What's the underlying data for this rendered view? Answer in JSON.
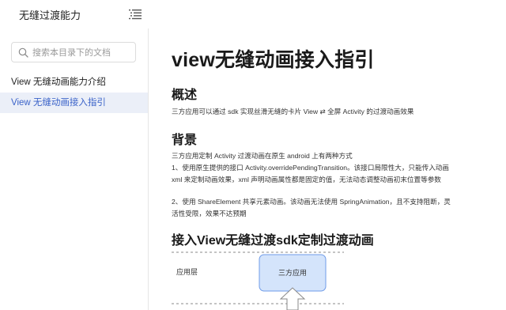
{
  "sidebar": {
    "title": "无缝过渡能力",
    "search_placeholder": "搜索本目录下的文档",
    "items": [
      {
        "label": "View 无缝动画能力介绍",
        "active": false
      },
      {
        "label": "View 无缝动画接入指引",
        "active": true
      }
    ]
  },
  "article": {
    "title": "view无缝动画接入指引",
    "sections": [
      {
        "heading": "概述",
        "paragraphs": [
          "三方应用可以通过 sdk 实现丝滑无缝的卡片 View ⇄ 全屏 Activity 的过渡动画效果"
        ]
      },
      {
        "heading": "背景",
        "paragraphs": [
          "三方应用定制 Activity 过渡动画在原生 android 上有两种方式",
          "1、使用原生提供的接口 Activity.overridePendingTransition。该接口局限性大，只能传入动画 xml 来定制动画效果，xml 声明动画属性都是固定的值，无法动态调整动画初末位置等参数",
          "2、使用 ShareElement 共享元素动画。该动画无法使用 SpringAnimation，且不支持阻断，灵活性受限，效果不达预期"
        ]
      },
      {
        "heading": "接入View无缝过渡sdk定制过渡动画",
        "paragraphs": []
      }
    ],
    "diagram": {
      "layer_label": "应用层",
      "box_label": "三方应用"
    }
  },
  "icons": {
    "menu": "list-menu-icon",
    "search": "search-icon",
    "arrow": "down-arrow-icon"
  },
  "colors": {
    "accent": "#3b63c9",
    "active_bg": "#ebeff8",
    "diagram_box_fill": "#d4e4fb",
    "diagram_box_stroke": "#6f9be8"
  }
}
